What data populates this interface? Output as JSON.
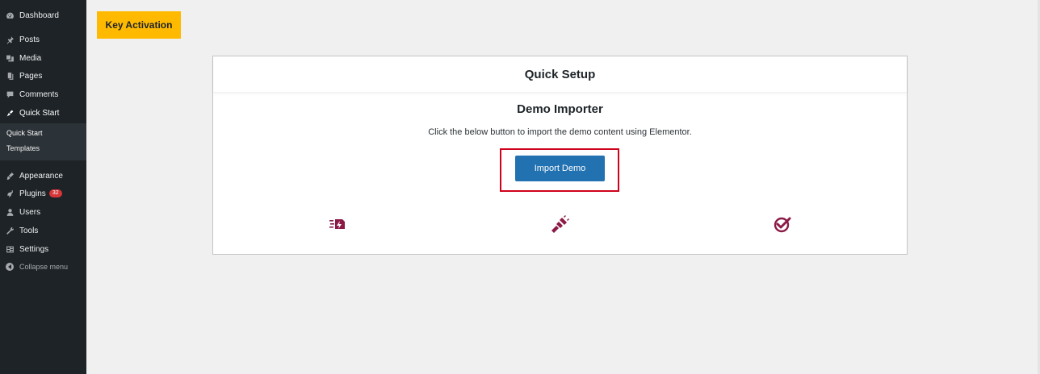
{
  "sidebar": {
    "items": [
      {
        "label": "Dashboard",
        "icon": "dashboard-icon"
      },
      {
        "label": "Posts",
        "icon": "pin-icon"
      },
      {
        "label": "Media",
        "icon": "media-icon"
      },
      {
        "label": "Pages",
        "icon": "pages-icon"
      },
      {
        "label": "Comments",
        "icon": "comment-icon"
      },
      {
        "label": "Quick Start",
        "icon": "quick-start-icon"
      },
      {
        "label": "Appearance",
        "icon": "brush-icon"
      },
      {
        "label": "Plugins",
        "icon": "plugin-icon",
        "badge": "32"
      },
      {
        "label": "Users",
        "icon": "user-icon"
      },
      {
        "label": "Tools",
        "icon": "wrench-icon"
      },
      {
        "label": "Settings",
        "icon": "settings-icon"
      }
    ],
    "submenu": [
      "Quick Start",
      "Templates"
    ],
    "collapse_label": "Collapse menu"
  },
  "key_activation_label": "Key Activation",
  "card": {
    "header": "Quick Setup",
    "title": "Demo Importer",
    "description": "Click the below button to import the demo content using Elementor.",
    "import_button_label": "Import Demo"
  },
  "feature_icons": [
    "fast-import-icon",
    "plug-connect-icon",
    "check-done-icon"
  ],
  "colors": {
    "sidebar_bg": "#1d2327",
    "accent_yellow": "#ffba00",
    "button_blue": "#2271b1",
    "highlight_red": "#d0021b",
    "icon_maroon": "#8c1a46",
    "badge_red": "#d63638"
  }
}
